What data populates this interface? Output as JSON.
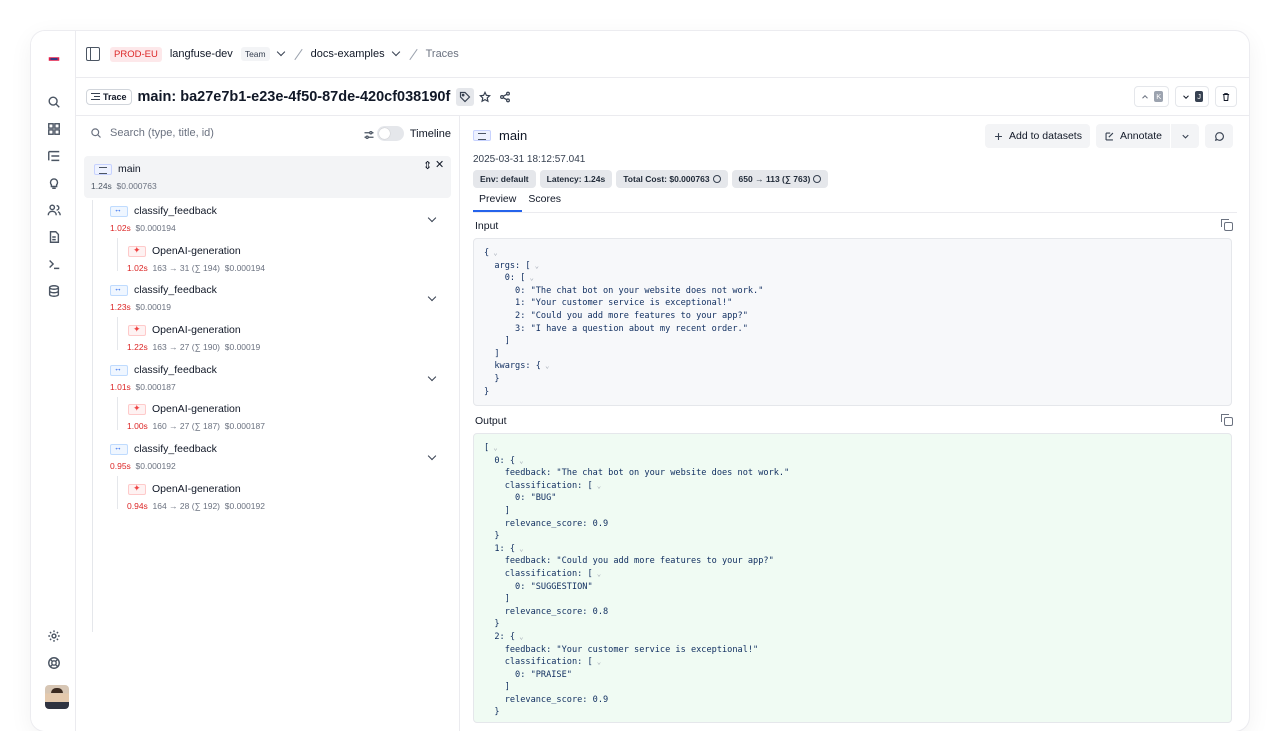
{
  "rail": {
    "icons": [
      "logo-icon",
      "search-icon",
      "dashboard-icon",
      "traces-icon",
      "lightbulb-icon",
      "users-icon",
      "prompts-icon",
      "terminal-icon",
      "database-icon",
      "settings-icon",
      "support-icon"
    ]
  },
  "topbar": {
    "env": "PROD-EU",
    "org": "langfuse-dev",
    "team_badge": "Team",
    "project": "docs-examples",
    "section": "Traces"
  },
  "header": {
    "badge": "Trace",
    "title": "main: ba27e7b1-e23e-4f50-87de-420cf038190f",
    "prev_key": "K",
    "next_key": "J"
  },
  "tree": {
    "search_placeholder": "Search (type, title, id)",
    "timeline_label": "Timeline",
    "root": {
      "name": "main",
      "latency": "1.24s",
      "cost": "$0.000763"
    },
    "spans": [
      {
        "name": "classify_feedback",
        "latency": "1.02s",
        "cost": "$0.000194",
        "gen": {
          "name": "OpenAI-generation",
          "latency": "1.02s",
          "tokens": "163 → 31 (∑ 194)",
          "cost": "$0.000194"
        }
      },
      {
        "name": "classify_feedback",
        "latency": "1.23s",
        "cost": "$0.00019",
        "gen": {
          "name": "OpenAI-generation",
          "latency": "1.22s",
          "tokens": "163 → 27 (∑ 190)",
          "cost": "$0.00019"
        }
      },
      {
        "name": "classify_feedback",
        "latency": "1.01s",
        "cost": "$0.000187",
        "gen": {
          "name": "OpenAI-generation",
          "latency": "1.00s",
          "tokens": "160 → 27 (∑ 187)",
          "cost": "$0.000187"
        }
      },
      {
        "name": "classify_feedback",
        "latency": "0.95s",
        "cost": "$0.000192",
        "gen": {
          "name": "OpenAI-generation",
          "latency": "0.94s",
          "tokens": "164 → 28 (∑ 192)",
          "cost": "$0.000192"
        }
      }
    ]
  },
  "detail": {
    "title": "main",
    "timestamp": "2025-03-31 18:12:57.041",
    "pills": [
      "Env: default",
      "Latency: 1.24s",
      "Total Cost: $0.000763",
      "650 → 113 (∑ 763)"
    ],
    "tabs": [
      "Preview",
      "Scores"
    ],
    "add_to_datasets": "Add to datasets",
    "annotate": "Annotate",
    "input_label": "Input",
    "output_label": "Output",
    "input_lines": [
      "{",
      "  args: [",
      "    0: [",
      "      0: \"The chat bot on your website does not work.\"",
      "      1: \"Your customer service is exceptional!\"",
      "      2: \"Could you add more features to your app?\"",
      "      3: \"I have a question about my recent order.\"",
      "    ]",
      "  ]",
      "  kwargs: {",
      "  }",
      "}"
    ],
    "output_lines": [
      "[",
      "  0: {",
      "    feedback: \"The chat bot on your website does not work.\"",
      "    classification: [",
      "      0: \"BUG\"",
      "    ]",
      "    relevance_score: 0.9",
      "  }",
      "  1: {",
      "    feedback: \"Could you add more features to your app?\"",
      "    classification: [",
      "      0: \"SUGGESTION\"",
      "    ]",
      "    relevance_score: 0.8",
      "  }",
      "  2: {",
      "    feedback: \"Your customer service is exceptional!\"",
      "    classification: [",
      "      0: \"PRAISE\"",
      "    ]",
      "    relevance_score: 0.9",
      "  }"
    ]
  }
}
